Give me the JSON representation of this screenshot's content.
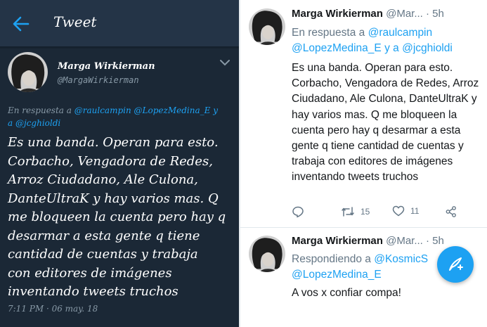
{
  "left_panel": {
    "header_title": "Tweet",
    "tweet": {
      "display_name": "Marga Wirkierman",
      "handle": "@MargaWirkierman",
      "reply_prefix": "En respuesta a",
      "reply_mentions": [
        "@raulcampin",
        "@LopezMedina_E",
        "y",
        "a",
        "@jcghioldi"
      ],
      "body": "Es una banda. Operan para esto.\nCorbacho, Vengadora de Redes,\nArroz Ciudadano, Ale Culona,\nDanteUltraK y hay varios mas. Q\nme bloqueen la cuenta pero hay q\ndesarmar a esta gente q tiene\ncantidad de cuentas y trabaja\ncon editores de imágenes\ninventando tweets truchos",
      "timestamp": "7:11 PM · 06 may. 18"
    }
  },
  "right_panel": {
    "tweets": [
      {
        "display_name": "Marga Wirkierman",
        "handle_truncated": "@Mar...",
        "time": "· 5h",
        "reply_prefix": "En respuesta a",
        "reply_mention_1": "@raulcampin",
        "reply_mention_2": "@LopezMedina_E",
        "reply_joiner": "y a",
        "reply_mention_3": "@jcghioldi",
        "body": "Es una banda. Operan para esto. Corbacho, Vengadora de Redes, Arroz Ciudadano, Ale Culona, DanteUltraK y hay varios mas. Q me bloqueen la cuenta pero hay q desarmar a esta gente q tiene cantidad de cuentas y trabaja con editores de imágenes inventando tweets truchos",
        "retweets": "15",
        "likes": "11"
      },
      {
        "display_name": "Marga Wirkierman",
        "handle_truncated": "@Mar...",
        "time": "· 5h",
        "reply_prefix": "Respondiendo a",
        "reply_mention_1": "@KosmicS",
        "reply_mention_2": "@LopezMedina_E",
        "body": "A vos x confiar compa!"
      }
    ]
  },
  "icons": {
    "back": "arrow-left-icon",
    "menu": "chevron-down-icon",
    "reply": "reply-icon",
    "retweet": "retweet-icon",
    "like": "heart-icon",
    "share": "share-icon",
    "compose": "compose-icon"
  },
  "colors": {
    "dark_bg": "#1b2836",
    "dark_header": "#243447",
    "accent": "#1da1f2",
    "muted": "#8899a6",
    "light_text": "#14171a",
    "light_muted": "#657786"
  }
}
